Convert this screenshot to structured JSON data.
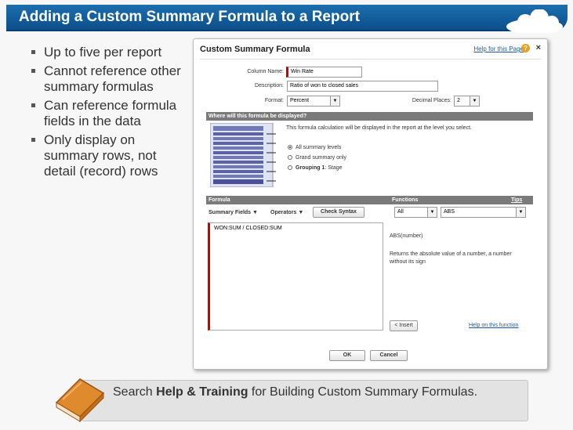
{
  "slide": {
    "title": "Adding a Custom Summary Formula to a Report",
    "bullets": [
      "Up to five per report",
      "Cannot reference other summary formulas",
      "Can reference formula fields in the data",
      "Only display on summary rows, not detail (record) rows"
    ],
    "footer": {
      "pre": "Search ",
      "bold": "Help & Training",
      "post": " for Building Custom Summary Formulas."
    }
  },
  "dialog": {
    "title": "Custom Summary Formula",
    "help_link": "Help for this Page",
    "close": "×",
    "fields": {
      "column_name_label": "Column Name:",
      "column_name_value": "Win Rate",
      "description_label": "Description:",
      "description_value": "Ratio of won to closed sales",
      "format_label": "Format:",
      "format_value": "Percent",
      "decimal_label": "Decimal Places:",
      "decimal_value": "2"
    },
    "display_section": {
      "header": "Where will this formula be displayed?",
      "info": "This formula calculation will be displayed in the report at the level you select.",
      "options": [
        {
          "label": "All summary levels",
          "bold": "",
          "suffix": "",
          "selected": true
        },
        {
          "label": "Grand summary only",
          "bold": "",
          "suffix": "",
          "selected": false
        },
        {
          "label": "",
          "bold": "Grouping 1",
          "suffix": ": Stage",
          "selected": false
        }
      ]
    },
    "formula_section": {
      "header": "Formula",
      "functions_header": "Functions",
      "tips_link": "Tips",
      "summary_fields": "Summary Fields",
      "operators": "Operators",
      "check_syntax": "Check Syntax",
      "function_category": "All",
      "function_selected": "ABS",
      "formula_text": "WON:SUM / CLOSED:SUM",
      "function_signature": "ABS(number)",
      "function_description": "Returns the absolute value of a number, a number without its sign",
      "insert_button": "< Insert",
      "help_function_link": "Help on this function"
    },
    "buttons": {
      "ok": "OK",
      "cancel": "Cancel"
    }
  },
  "colors": {
    "title_bar": "#0b4f8a",
    "section_bar": "#7a7a7a",
    "required": "#cc0000",
    "link": "#1e5a9c"
  },
  "icons": [
    "cloud-icon",
    "help-icon",
    "close-icon",
    "book-icon",
    "report-levels-illustration"
  ]
}
